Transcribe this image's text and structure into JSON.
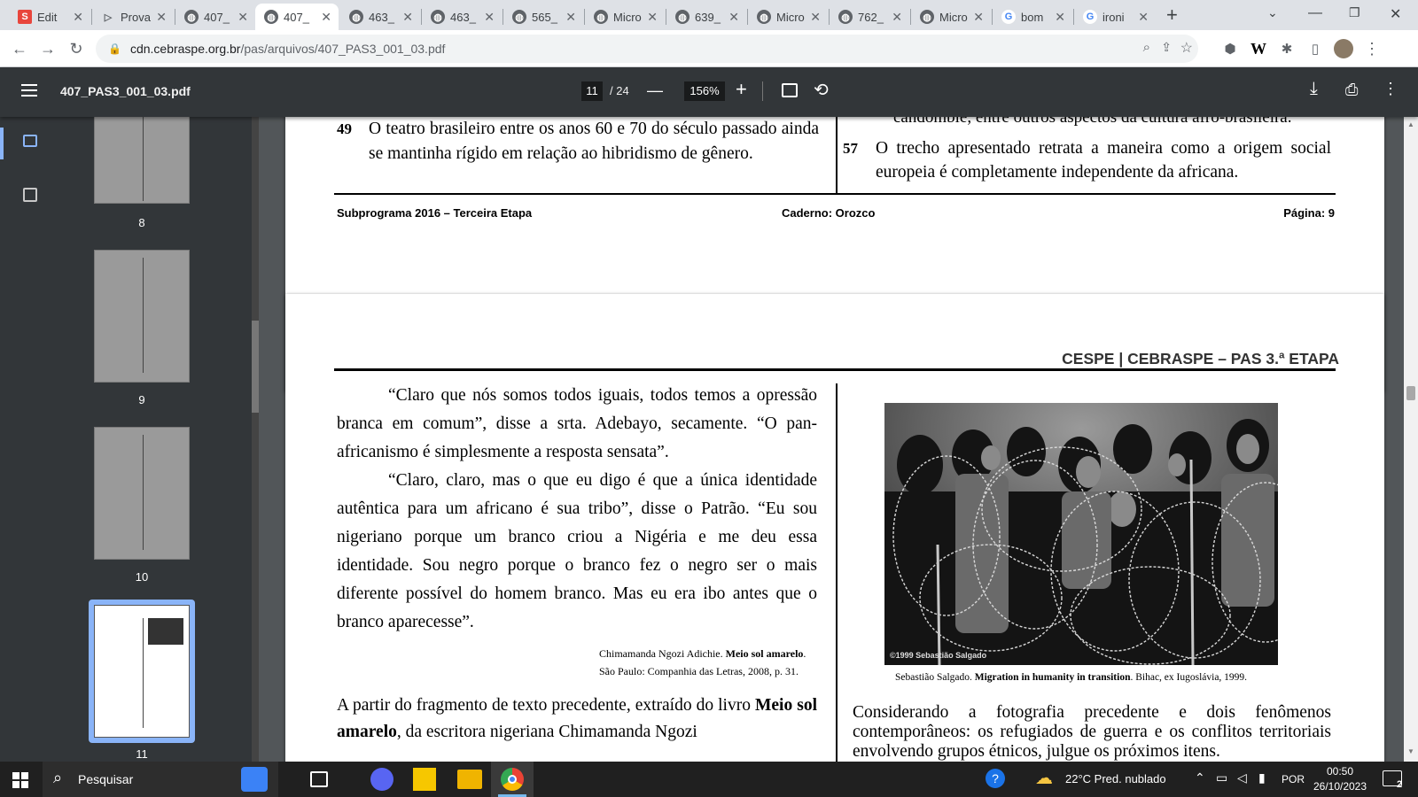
{
  "tabs": [
    {
      "title": "Edit"
    },
    {
      "title": "Prova"
    },
    {
      "title": "407_"
    },
    {
      "title": "407_"
    },
    {
      "title": "463_"
    },
    {
      "title": "463_"
    },
    {
      "title": "565_"
    },
    {
      "title": "Micro"
    },
    {
      "title": "639_"
    },
    {
      "title": "Micro"
    },
    {
      "title": "762_"
    },
    {
      "title": "Micro"
    },
    {
      "title": "bom"
    },
    {
      "title": "ironi"
    }
  ],
  "url": {
    "host": "cdn.cebraspe.org.br",
    "path": "/pas/arquivos/407_PAS3_001_03.pdf"
  },
  "pdf": {
    "filename": "407_PAS3_001_03.pdf",
    "current_page": "11",
    "total_pages": "/ 24",
    "zoom": "156%"
  },
  "thumbnails": [
    {
      "num": "8"
    },
    {
      "num": "9"
    },
    {
      "num": "10"
    },
    {
      "num": "11"
    }
  ],
  "page_top": {
    "q49_num": "49",
    "q49_text": "O teatro brasileiro entre os anos 60 e 70 do século passado ainda se mantinha rígido em relação ao hibridismo de gênero.",
    "right_cut": "candomblé, entre outros aspectos da cultura afro-brasileira.",
    "q57_num": "57",
    "q57_text": "O trecho apresentado retrata a maneira como a origem social europeia é completamente independente da africana.",
    "footer_left": "Subprograma 2016 – Terceira Etapa",
    "footer_center": "Caderno: Orozco",
    "footer_right": "Página: 9"
  },
  "page_main": {
    "header": "CESPE | CEBRASPE – PAS 3.ª ETAPA",
    "para1": "“Claro que nós somos todos iguais, todos temos a opressão branca em comum”, disse a srta. Adebayo, secamente. “O pan-africanismo é simplesmente a resposta sensata”.",
    "para2": "“Claro, claro, mas o que eu digo é que a única identidade autêntica para um africano é sua tribo”, disse o Patrão. “Eu sou nigeriano porque um branco criou a Nigéria e me deu essa identidade. Sou negro porque o branco fez o negro ser o mais diferente possível do homem branco. Mas eu era ibo antes que o branco aparecesse”.",
    "cite_author": "Chimamanda Ngozi Adichie. ",
    "cite_title": "Meio sol amarelo",
    "cite_rest": ".",
    "cite_line2": "São Paulo: Companhia das Letras, 2008, p. 31.",
    "question_a": "A partir do fragmento de texto precedente, extraído do livro ",
    "question_bold": "Meio sol amarelo",
    "question_b": ", da escritora nigeriana Chimamanda Ngozi",
    "photo_watermark": "©1999 Sebastião Salgado",
    "photo_cap_a": "Sebastião Salgado. ",
    "photo_cap_bold": "Migration in humanity in transition",
    "photo_cap_b": ". Bihac, ex Iugoslávia, 1999.",
    "right_text": "Considerando a fotografia precedente e dois fenômenos contemporâneos: os refugiados de guerra e os conflitos territoriais envolvendo grupos étnicos, julgue os próximos itens."
  },
  "taskbar": {
    "search": "Pesquisar",
    "weather": "22°C  Pred. nublado",
    "lang": "POR",
    "time": "00:50",
    "date": "26/10/2023",
    "notif": "2"
  }
}
